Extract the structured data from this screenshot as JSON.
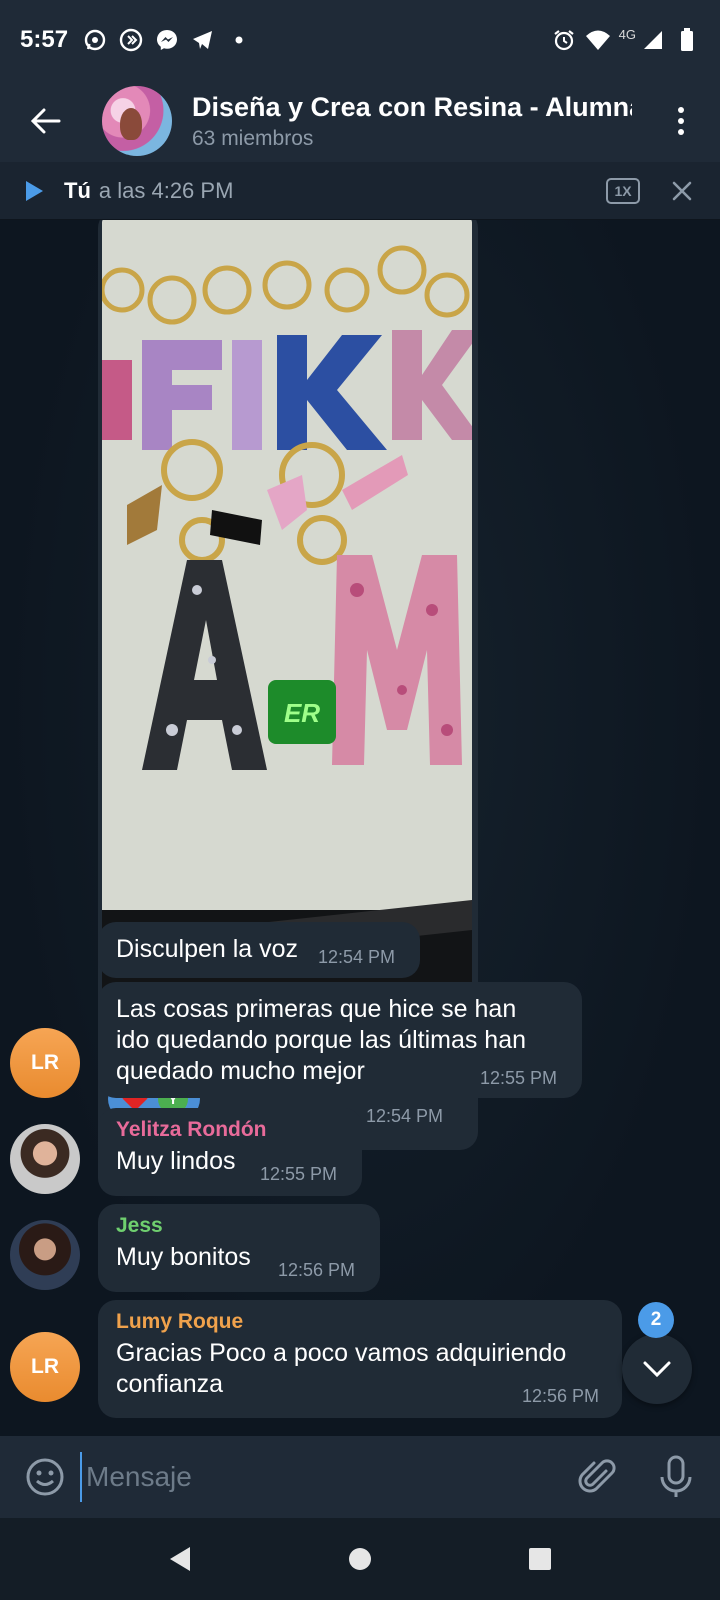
{
  "status_bar": {
    "time": "5:57",
    "network": "4G",
    "left_icons": [
      "whatsapp-icon",
      "shazam-icon",
      "messenger-icon",
      "telegram-icon",
      "dot-icon"
    ],
    "right_icons": [
      "alarm-icon",
      "wifi-icon",
      "signal-icon",
      "battery-icon"
    ]
  },
  "header": {
    "title": "Diseña y Crea con Resina - Alumnas",
    "subtitle": "63 miembros"
  },
  "player": {
    "name": "Tú",
    "time": "a las 4:26 PM",
    "speed": "1X"
  },
  "messages": [
    {
      "type": "photo",
      "overlay_text": "ER",
      "reaction_avatar": "Y",
      "time": "12:54 PM"
    },
    {
      "type": "text",
      "text": "Disculpen la voz",
      "time": "12:54 PM"
    },
    {
      "type": "text",
      "sender_avatar": "LR",
      "text_lines": [
        "Las cosas primeras que hice se han",
        "ido quedando porque las últimas han",
        "quedado mucho mejor"
      ],
      "time": "12:55 PM"
    },
    {
      "type": "text",
      "sender": "Yelitza Rondón",
      "sender_color": "#e86b9a",
      "text": "Muy lindos",
      "time": "12:55 PM"
    },
    {
      "type": "text",
      "sender": "Jess",
      "sender_color": "#6fcf6f",
      "text": "Muy bonitos",
      "time": "12:56 PM"
    },
    {
      "type": "text",
      "sender": "Lumy Roque",
      "sender_color": "#f0a24c",
      "sender_avatar": "LR",
      "text_lines": [
        "Gracias Poco a poco vamos adquiriendo",
        "confianza"
      ],
      "time": "12:56 PM"
    }
  ],
  "scroll_badge": "2",
  "input": {
    "placeholder": "Mensaje"
  },
  "colors": {
    "accent": "#4b9be8",
    "bubble": "#202b36",
    "header": "#1f2a37"
  }
}
